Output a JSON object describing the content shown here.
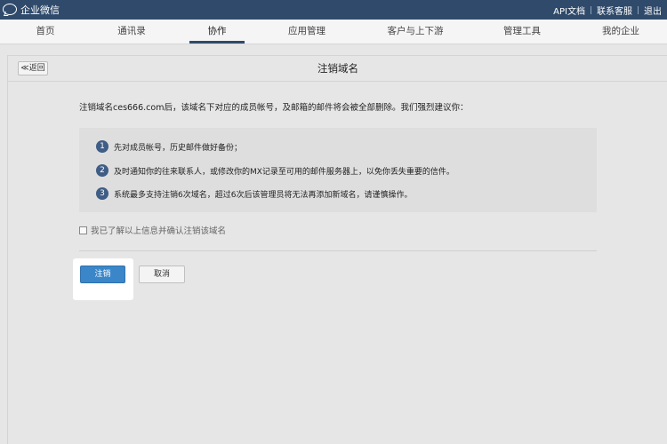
{
  "topbar": {
    "app_title": "企业微信",
    "links": [
      "API文档",
      "联系客服",
      "退出"
    ]
  },
  "nav": {
    "items": [
      "首页",
      "通讯录",
      "协作",
      "应用管理",
      "客户与上下游",
      "管理工具",
      "我的企业"
    ],
    "active": "协作"
  },
  "page": {
    "back_label": "≪返回",
    "title": "注销域名",
    "intro": "注销域名ces666.com后，该域名下对应的成员帐号，及邮箱的邮件将会被全部删除。我们强烈建议你：",
    "tips": [
      {
        "num": "1",
        "text": "先对成员帐号，历史邮件做好备份；"
      },
      {
        "num": "2",
        "text": "及时通知你的往来联系人，或修改你的MX记录至可用的邮件服务器上，以免你丢失重要的信件。"
      },
      {
        "num": "3",
        "text": "系统最多支持注销6次域名，超过6次后该管理员将无法再添加新域名，请谨慎操作。"
      }
    ],
    "confirm_label": "我已了解以上信息并确认注销该域名",
    "confirm_checked": false,
    "submit_label": "注销",
    "cancel_label": "取消"
  },
  "colors": {
    "topbar": "#2f4a6b",
    "primary_button": "#3a86c8",
    "tip_badge": "#3f5d85"
  }
}
